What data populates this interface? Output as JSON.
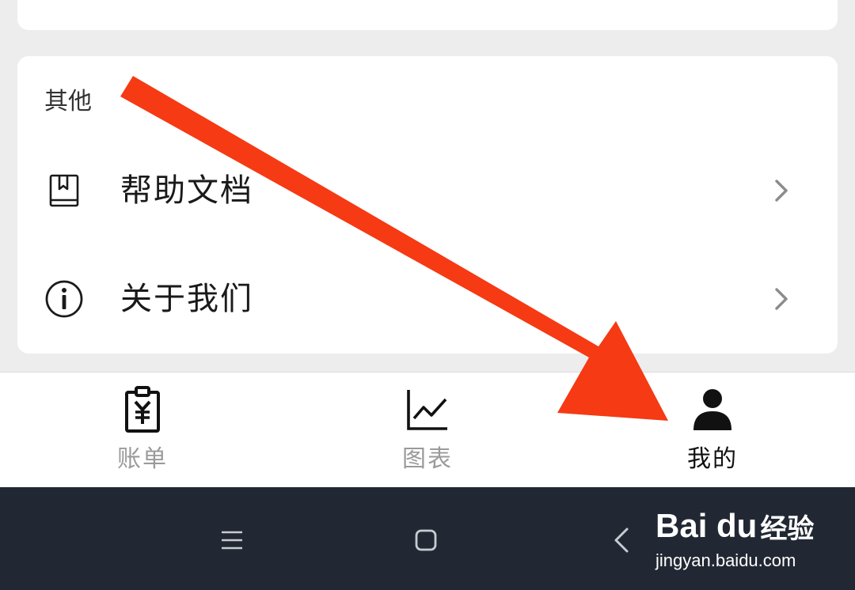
{
  "section": {
    "title": "其他",
    "items": [
      {
        "label": "帮助文档",
        "icon": "book-icon"
      },
      {
        "label": "关于我们",
        "icon": "info-icon"
      }
    ]
  },
  "tabs": [
    {
      "label": "账单",
      "icon": "bill-clipboard-icon",
      "active": false
    },
    {
      "label": "图表",
      "icon": "line-chart-icon",
      "active": false
    },
    {
      "label": "我的",
      "icon": "person-icon",
      "active": true
    }
  ],
  "watermark": {
    "brand": "Bai du",
    "product": "经验",
    "url": "jingyan.baidu.com"
  },
  "colors": {
    "background": "#ededed",
    "card": "#ffffff",
    "tab_inactive": "#9a9a9a",
    "tab_active": "#111111",
    "navbar": "#222833",
    "annotation_arrow": "#f53a14"
  }
}
